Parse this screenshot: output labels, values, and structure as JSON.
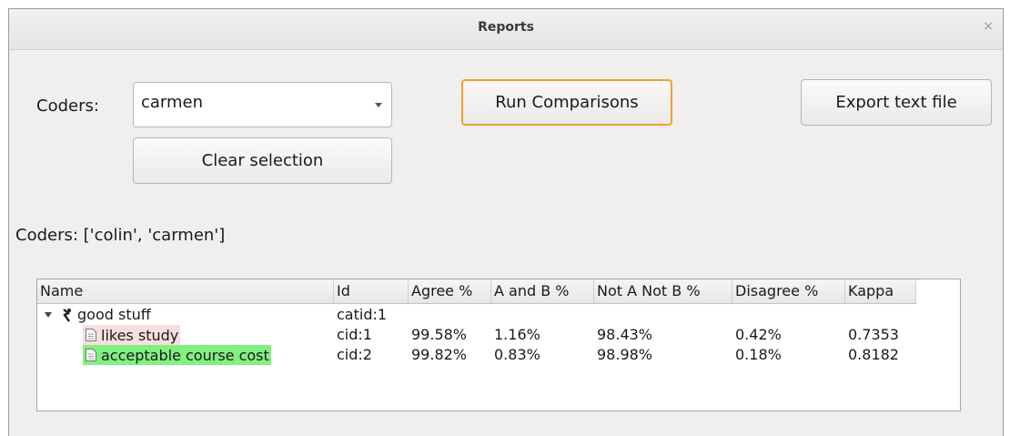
{
  "window": {
    "title": "Reports",
    "close_glyph": "×",
    "close_icon": "close-icon"
  },
  "controls": {
    "coders_label": "Coders:",
    "coder_selected": "carmen",
    "clear_label": "Clear selection",
    "run_label": "Run Comparisons",
    "export_label": "Export text file",
    "coders_result": "Coders: ['colin', 'carmen']"
  },
  "colors": {
    "focus_border": "#f0a030",
    "row_pink": "#f8dede",
    "row_green": "#80f080"
  },
  "table": {
    "headers": [
      "Name",
      "Id",
      "Agree %",
      "A and B %",
      "Not A Not B %",
      "Disagree %",
      "Kappa"
    ],
    "category": {
      "name": "good stuff",
      "id": "catid:1",
      "icon": "category-icon",
      "expanded": true
    },
    "rows": [
      {
        "name": "likes study",
        "id": "cid:1",
        "agree": "99.58%",
        "a_and_b": "1.16%",
        "not_a_not_b": "98.43%",
        "disagree": "0.42%",
        "kappa": "0.7353",
        "icon": "document-icon",
        "highlight": "#f8dede"
      },
      {
        "name": "acceptable course cost",
        "id": "cid:2",
        "agree": "99.82%",
        "a_and_b": "0.83%",
        "not_a_not_b": "98.98%",
        "disagree": "0.18%",
        "kappa": "0.8182",
        "icon": "document-icon",
        "highlight": "#80f080"
      }
    ]
  }
}
